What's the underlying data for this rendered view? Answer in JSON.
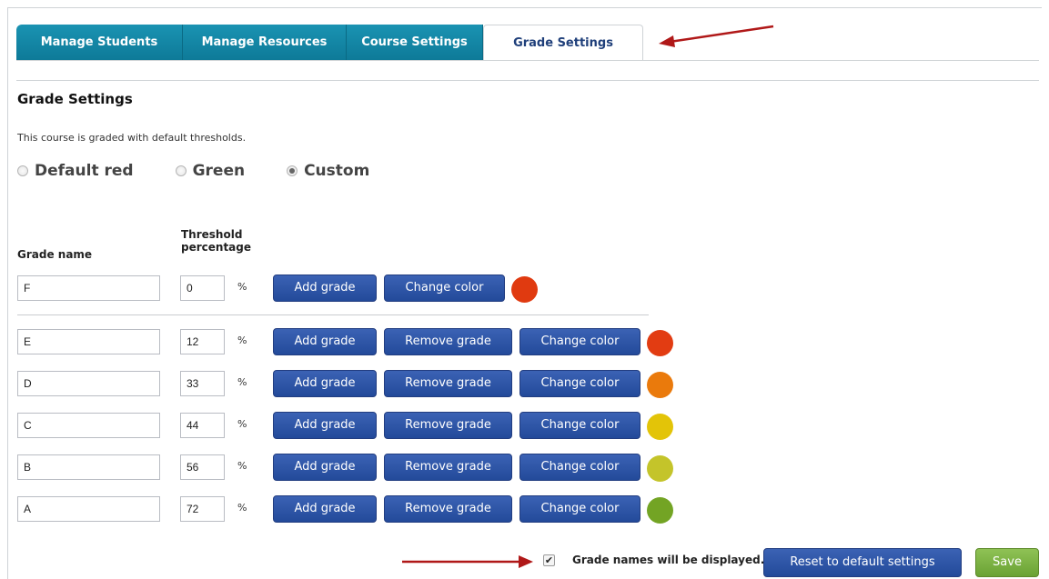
{
  "tabs": [
    {
      "label": "Manage Students"
    },
    {
      "label": "Manage Resources"
    },
    {
      "label": "Course Settings"
    },
    {
      "label": "Grade Settings"
    }
  ],
  "section": {
    "title": "Grade Settings",
    "description": "This course is graded with default thresholds."
  },
  "presets": {
    "options": [
      {
        "label": "Default red",
        "selected": false
      },
      {
        "label": "Green",
        "selected": false
      },
      {
        "label": "Custom",
        "selected": true
      }
    ]
  },
  "table": {
    "col_grade_name": "Grade name",
    "col_threshold_line1": "Threshold",
    "col_threshold_line2": "percentage",
    "percent_sign": "%",
    "add_label": "Add grade",
    "remove_label": "Remove grade",
    "change_color_label": "Change color",
    "rows": [
      {
        "name": "F",
        "threshold": "0",
        "color": "#e03a10"
      },
      {
        "name": "E",
        "threshold": "12",
        "color": "#e23c12"
      },
      {
        "name": "D",
        "threshold": "33",
        "color": "#ea7a0c"
      },
      {
        "name": "C",
        "threshold": "44",
        "color": "#e3c408"
      },
      {
        "name": "B",
        "threshold": "56",
        "color": "#c4c42a"
      },
      {
        "name": "A",
        "threshold": "72",
        "color": "#73a424"
      }
    ]
  },
  "footer": {
    "display_names_checked": true,
    "display_names_label": "Grade names will be displayed.",
    "reset_label": "Reset to default settings",
    "save_label": "Save"
  },
  "colors": {
    "tab_bg": "#1586a5",
    "button_bg": "#2b53a6",
    "save_bg": "#7cb342",
    "arrow": "#b01818"
  }
}
